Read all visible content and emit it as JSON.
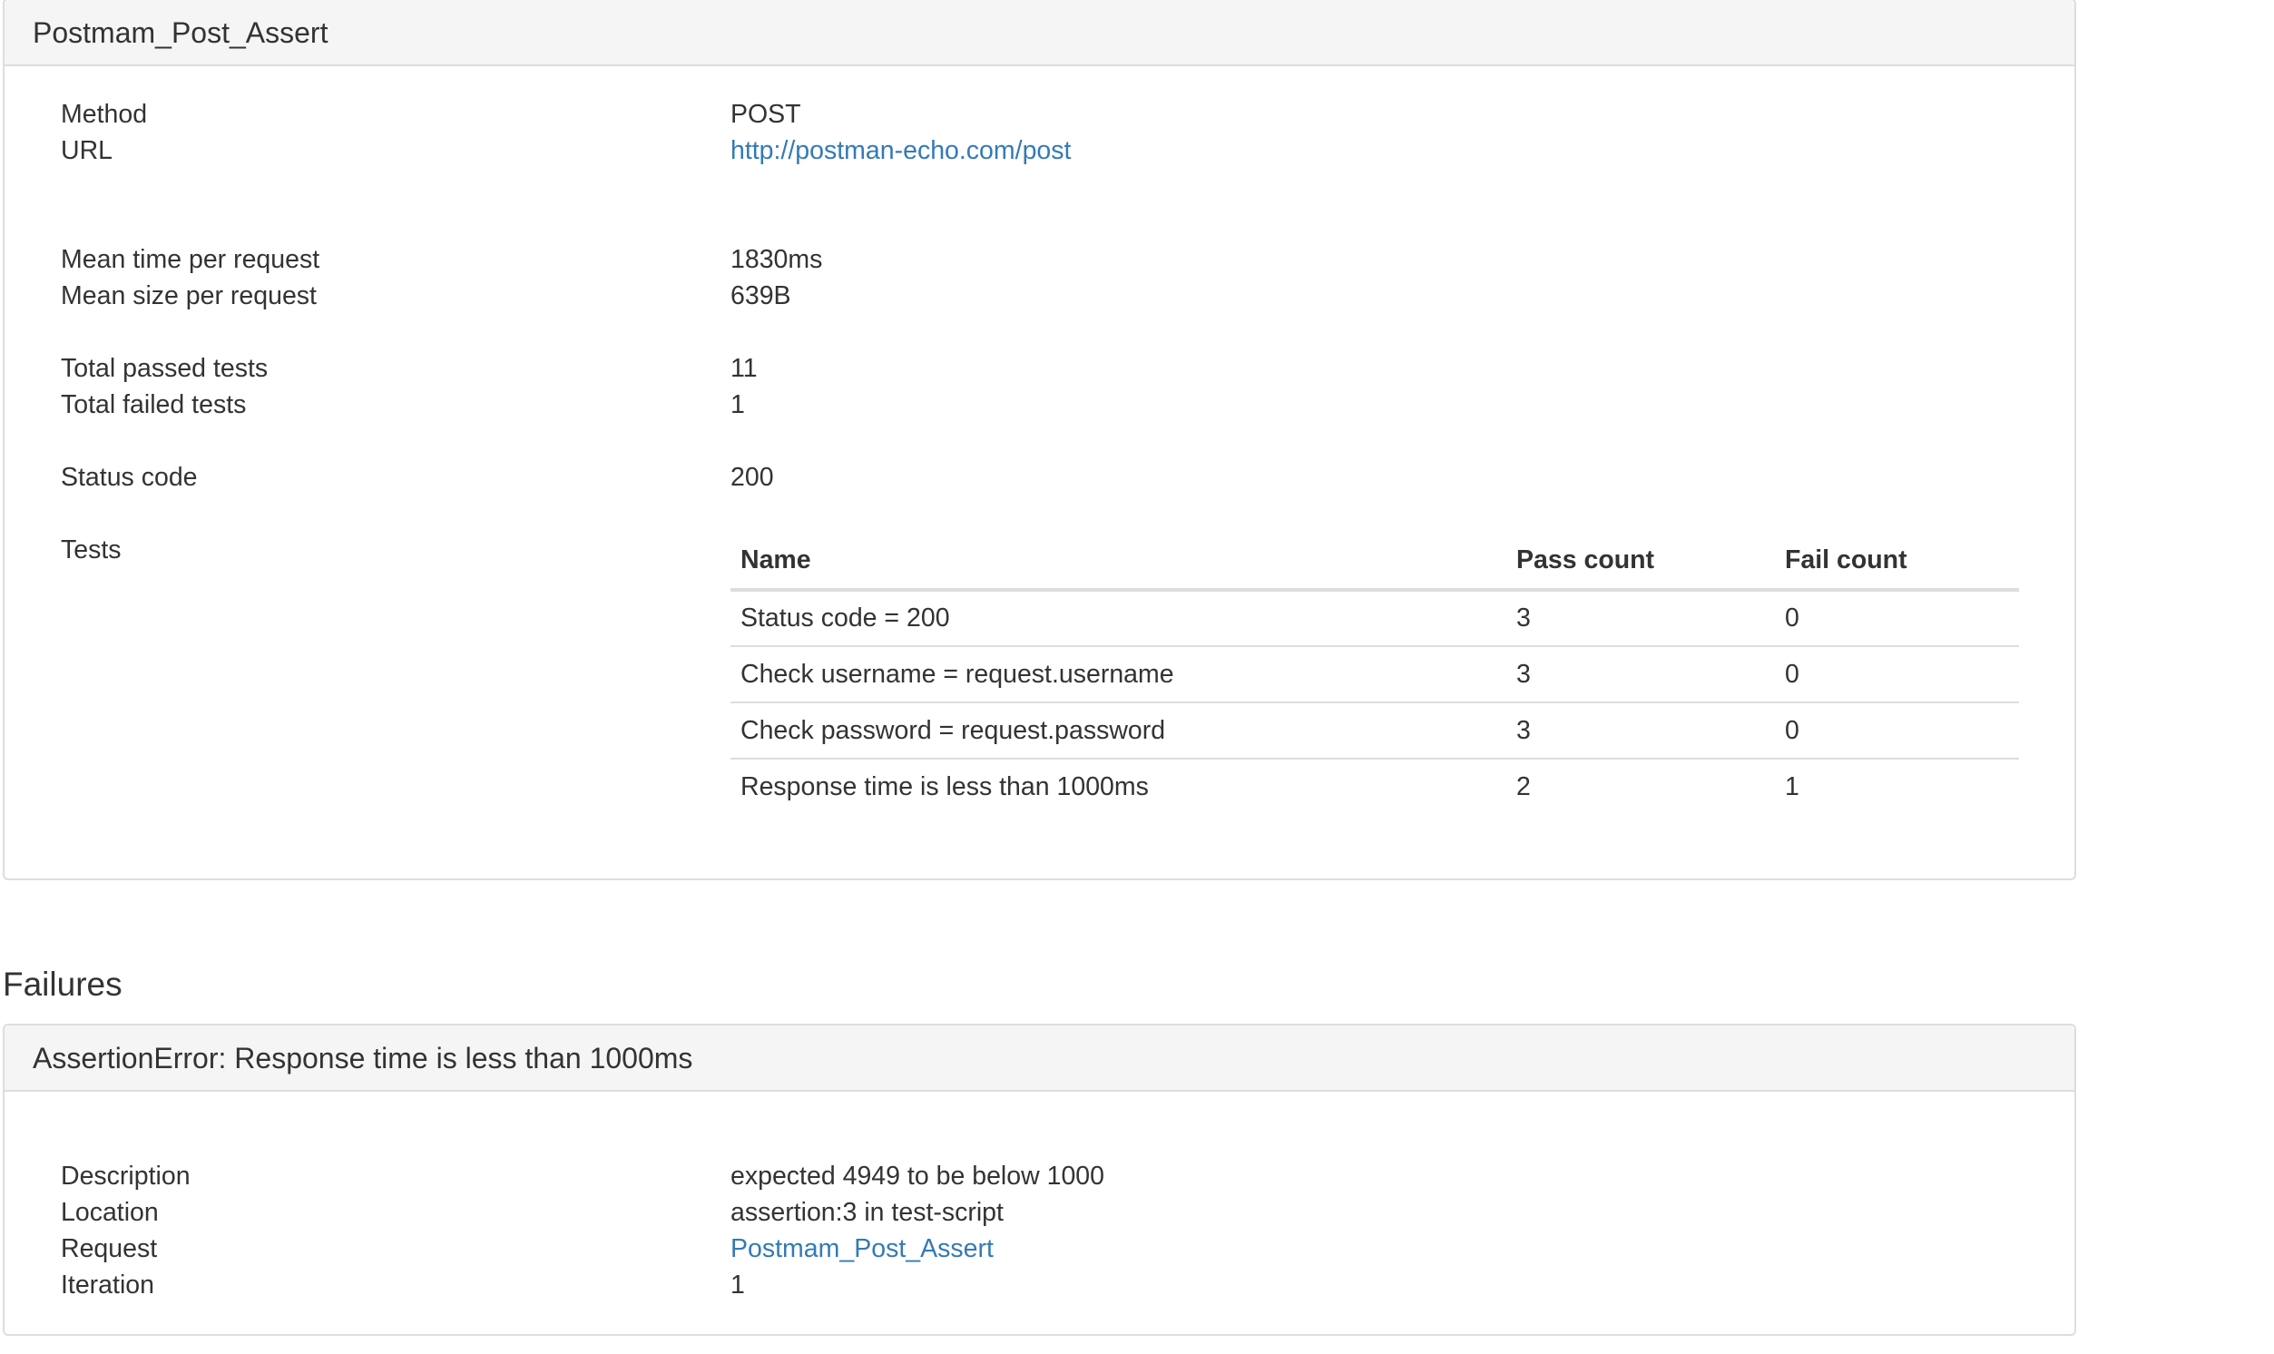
{
  "request_panel": {
    "title": "Postmam_Post_Assert",
    "fields": {
      "method_label": "Method",
      "method_value": "POST",
      "url_label": "URL",
      "url_value": "http://postman-echo.com/post",
      "mean_time_label": "Mean time per request",
      "mean_time_value": "1830ms",
      "mean_size_label": "Mean size per request",
      "mean_size_value": "639B",
      "passed_label": "Total passed tests",
      "passed_value": "11",
      "failed_label": "Total failed tests",
      "failed_value": "1",
      "status_label": "Status code",
      "status_value": "200",
      "tests_label": "Tests"
    },
    "tests_table": {
      "headers": [
        "Name",
        "Pass count",
        "Fail count"
      ],
      "rows": [
        [
          "Status code = 200",
          "3",
          "0"
        ],
        [
          "Check username = request.username",
          "3",
          "0"
        ],
        [
          "Check password = request.password",
          "3",
          "0"
        ],
        [
          "Response time is less than 1000ms",
          "2",
          "1"
        ]
      ]
    }
  },
  "failures": {
    "section_title": "Failures",
    "panel_title": "AssertionError: Response time is less than 1000ms",
    "fields": {
      "description_label": "Description",
      "description_value": "expected 4949 to be below 1000",
      "location_label": "Location",
      "location_value": "assertion:3 in test-script",
      "request_label": "Request",
      "request_value": "Postmam_Post_Assert",
      "iteration_label": "Iteration",
      "iteration_value": "1"
    }
  },
  "colors": {
    "link": "#337ab7",
    "panel_heading_bg": "#f5f5f5",
    "border": "#dddddd",
    "text": "#333333"
  }
}
